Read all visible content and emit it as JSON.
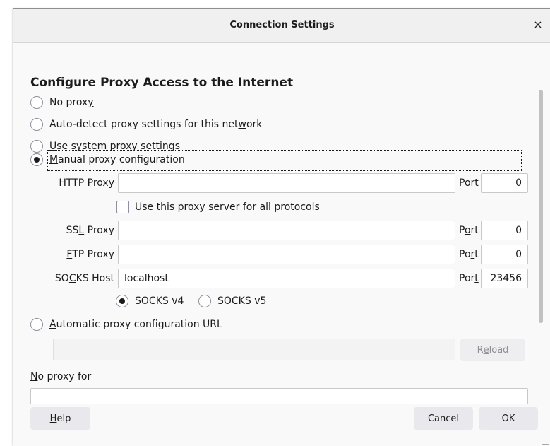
{
  "dialog": {
    "title": "Connection Settings",
    "close_symbol": "×",
    "heading": "Configure Proxy Access to the Internet"
  },
  "options": {
    "no_proxy": {
      "pre": "No prox",
      "key": "y",
      "post": ""
    },
    "auto_detect": {
      "pre": "Auto-detect proxy settings for this net",
      "key": "w",
      "post": "ork"
    },
    "system": {
      "pre": "",
      "key": "U",
      "post": "se system proxy settings"
    },
    "manual": {
      "pre": "",
      "key": "M",
      "post": "anual proxy configuration"
    },
    "auto_url": {
      "pre": "",
      "key": "A",
      "post": "utomatic proxy configuration URL"
    }
  },
  "selected_option": "manual",
  "http": {
    "label": {
      "pre": "HTTP Pro",
      "key": "x",
      "post": "y"
    },
    "host": "",
    "port_label": {
      "pre": "",
      "key": "P",
      "post": "ort"
    },
    "port": "0"
  },
  "use_all": {
    "label": {
      "pre": "U",
      "key": "s",
      "post": "e this proxy server for all protocols"
    },
    "checked": false
  },
  "ssl": {
    "label": {
      "pre": "SS",
      "key": "L",
      "post": " Proxy"
    },
    "host": "",
    "port_label": {
      "pre": "P",
      "key": "o",
      "post": "rt"
    },
    "port": "0"
  },
  "ftp": {
    "label": {
      "pre": "",
      "key": "F",
      "post": "TP Proxy"
    },
    "host": "",
    "port_label": {
      "pre": "Po",
      "key": "r",
      "post": "t"
    },
    "port": "0"
  },
  "socks": {
    "label": {
      "pre": "SO",
      "key": "C",
      "post": "KS Host"
    },
    "host": "localhost",
    "port_label": {
      "pre": "Por",
      "key": "t",
      "post": ""
    },
    "port": "23456",
    "v4": {
      "pre": "SOC",
      "key": "K",
      "post": "S v4"
    },
    "v5": {
      "pre": "SOCKS ",
      "key": "v",
      "post": "5"
    },
    "selected_version": "v4"
  },
  "pac": {
    "url": "",
    "reload": {
      "pre": "R",
      "key": "e",
      "post": "load"
    }
  },
  "no_proxy_for": {
    "label": {
      "pre": "",
      "key": "N",
      "post": "o proxy for"
    },
    "value": ""
  },
  "buttons": {
    "help": {
      "pre": "",
      "key": "H",
      "post": "elp"
    },
    "cancel": "Cancel",
    "ok": "OK"
  }
}
